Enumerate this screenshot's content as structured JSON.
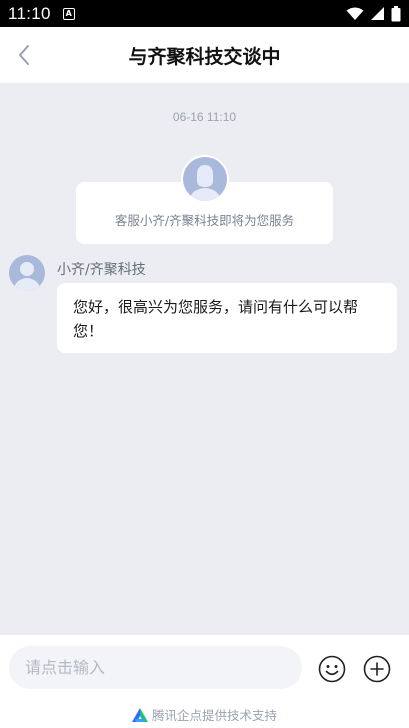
{
  "status_bar": {
    "time": "11:10",
    "notification_icon": "A"
  },
  "header": {
    "title": "与齐聚科技交谈中"
  },
  "chat": {
    "timestamp": "06-16 11:10",
    "system_message": "客服小齐/齐聚科技即将为您服务",
    "messages": [
      {
        "sender": "小齐/齐聚科技",
        "text": "您好，很高兴为您服务，请问有什么可以帮您！"
      }
    ]
  },
  "composer": {
    "placeholder": "请点击输入"
  },
  "footer": {
    "powered_by": "腾讯企点提供技术支持"
  },
  "colors": {
    "background": "#ebedf2",
    "avatar": "#a9b9dc",
    "brand_logo_blue": "#2f6bff",
    "brand_logo_green": "#1fc27a"
  }
}
